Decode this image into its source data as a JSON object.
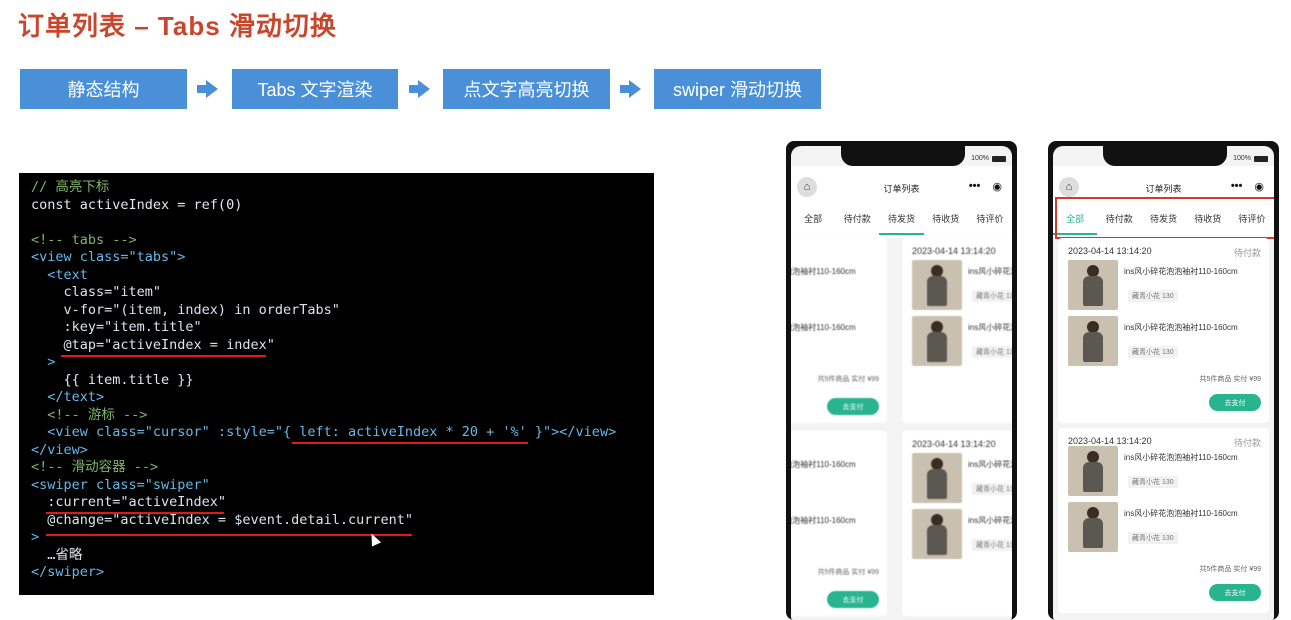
{
  "page": {
    "title": "订单列表 – Tabs 滑动切换"
  },
  "steps": [
    {
      "label": "静态结构"
    },
    {
      "label": "Tabs 文字渲染"
    },
    {
      "label": "点文字高亮切换"
    },
    {
      "label": "swiper 滑动切换"
    }
  ],
  "code": {
    "lines": [
      "// 高亮下标",
      "const activeIndex = ref(0)",
      "",
      "<!-- tabs -->",
      "<view class=\"tabs\">",
      "  <text",
      "    class=\"item\"",
      "    v-for=\"(item, index) in orderTabs\"",
      "    :key=\"item.title\"",
      "    @tap=\"activeIndex = index\"",
      "  >",
      "    {{ item.title }}",
      "  </text>",
      "  <!-- 游标 -->",
      "  <view class=\"cursor\" :style=\"{ left: activeIndex * 20 + '%' }\"></view>",
      "</view>",
      "<!-- 滑动容器 -->",
      "<swiper class=\"swiper\"",
      "  :current=\"activeIndex\"",
      "  @change=\"activeIndex = $event.detail.current\"",
      ">",
      "  …省略",
      "</swiper>"
    ]
  },
  "phone": {
    "battery": "100%",
    "nav_title": "订单列表",
    "capsule_more": "•••",
    "capsule_close": "◉",
    "home_icon": "⌂",
    "tabs": [
      "全部",
      "待付款",
      "待发货",
      "待收货",
      "待评价"
    ],
    "active_tab_index": 0,
    "orders": [
      {
        "time": "2023-04-14 13:14:20",
        "status": "待付款",
        "goods": [
          {
            "name": "ins风小碎花泡泡袖衬110-160cm",
            "spec": "藏青小花 130"
          },
          {
            "name": "ins风小碎花泡泡袖衬110-160cm",
            "spec": "藏青小花 130"
          }
        ],
        "summary": "共5件商品  实付 ¥99",
        "pay_label": "去支付"
      },
      {
        "time": "2023-04-14 13:14:20",
        "status": "待付款",
        "goods": [
          {
            "name": "ins风小碎花泡泡袖衬110-160cm",
            "spec": "藏青小花 130"
          },
          {
            "name": "ins风小碎花泡泡袖衬110-160cm",
            "spec": "藏青小花 130"
          }
        ],
        "summary": "共5件商品  实付 ¥99",
        "pay_label": "去支付"
      }
    ]
  }
}
